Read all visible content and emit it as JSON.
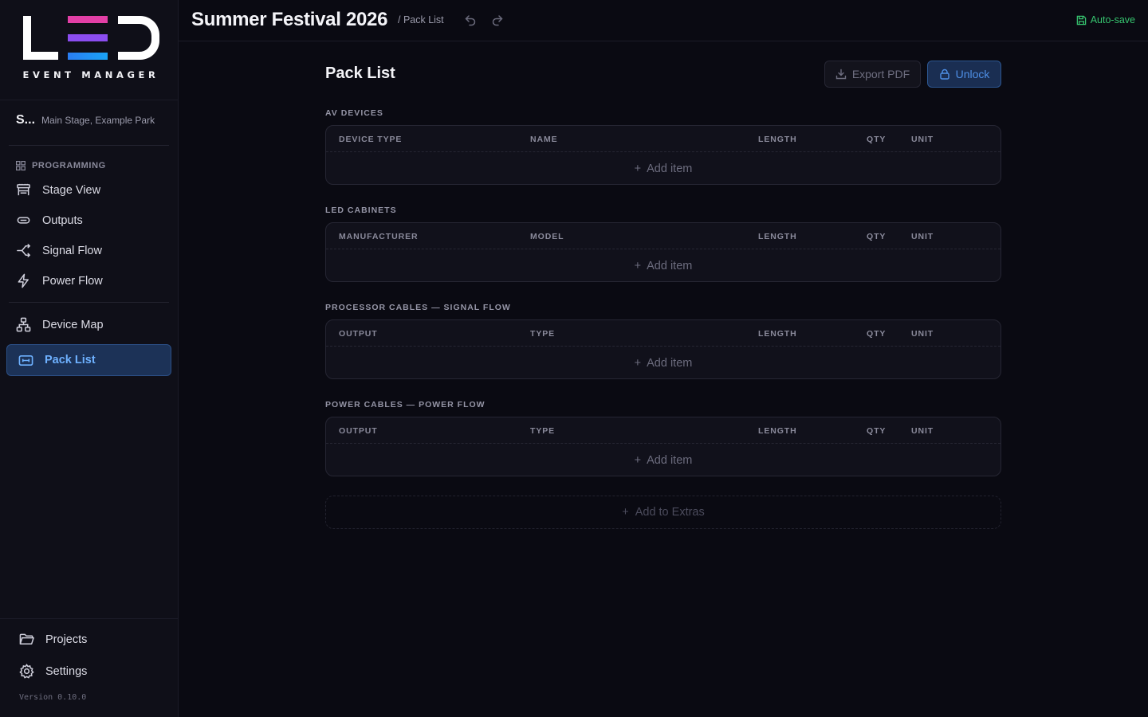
{
  "app": {
    "logo_letters": "LED",
    "tagline": "EVENT MANAGER",
    "version": "Version 0.10.0"
  },
  "project": {
    "abbr": "S...",
    "venue": "Main Stage, Example Park"
  },
  "sidebar": {
    "group_label": "PROGRAMMING",
    "items": [
      {
        "label": "Stage View",
        "icon": "stage-icon"
      },
      {
        "label": "Outputs",
        "icon": "outputs-icon"
      },
      {
        "label": "Signal Flow",
        "icon": "signal-flow-icon"
      },
      {
        "label": "Power Flow",
        "icon": "power-flow-icon"
      }
    ],
    "secondary": [
      {
        "label": "Device Map",
        "icon": "device-map-icon"
      },
      {
        "label": "Pack List",
        "icon": "pack-list-icon",
        "active": true
      }
    ],
    "footer": [
      {
        "label": "Projects",
        "icon": "folder-icon"
      },
      {
        "label": "Settings",
        "icon": "gear-icon"
      }
    ]
  },
  "header": {
    "title": "Summer Festival 2026",
    "breadcrumb": "/ Pack List",
    "autosave": "Auto-save"
  },
  "main": {
    "title": "Pack List",
    "export_label": "Export PDF",
    "unlock_label": "Unlock",
    "sections": [
      {
        "label": "AV DEVICES",
        "columns": [
          "DEVICE TYPE",
          "NAME",
          "LENGTH",
          "QTY",
          "UNIT"
        ],
        "add_label": "Add item"
      },
      {
        "label": "LED CABINETS",
        "columns": [
          "MANUFACTURER",
          "MODEL",
          "LENGTH",
          "QTY",
          "UNIT"
        ],
        "add_label": "Add item"
      },
      {
        "label": "PROCESSOR CABLES — SIGNAL FLOW",
        "columns": [
          "OUTPUT",
          "TYPE",
          "LENGTH",
          "QTY",
          "UNIT"
        ],
        "add_label": "Add item"
      },
      {
        "label": "POWER CABLES — POWER FLOW",
        "columns": [
          "OUTPUT",
          "TYPE",
          "LENGTH",
          "QTY",
          "UNIT"
        ],
        "add_label": "Add item"
      }
    ],
    "extras_label": "Add to Extras"
  },
  "colors": {
    "accent": "#6eb1ff",
    "autosave": "#36c46f",
    "background": "#0a0a12",
    "logo_gradient": [
      "#e23fa6",
      "#8b4df0",
      "#1f8ef5"
    ]
  }
}
